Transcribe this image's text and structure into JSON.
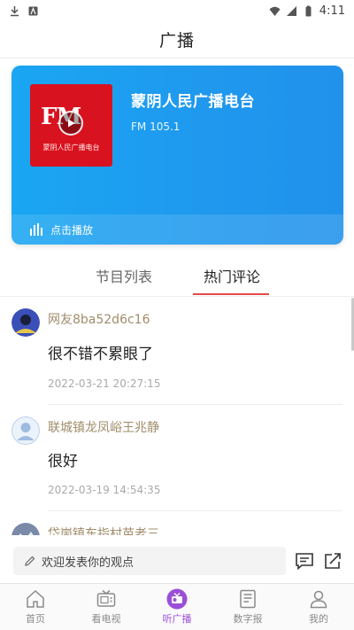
{
  "status_bar": {
    "time": "4:11"
  },
  "header": {
    "title": "广播"
  },
  "radio": {
    "cover_logo": "FM",
    "cover_caption": "蒙阴人民广播电台",
    "name": "蒙阴人民广播电台",
    "frequency": "FM 105.1",
    "play_label": "点击播放"
  },
  "tabs": [
    {
      "label": "节目列表",
      "active": false
    },
    {
      "label": "热门评论",
      "active": true
    }
  ],
  "comments": [
    {
      "username": "网友8ba52d6c16",
      "text": "很不错不累眼了",
      "time": "2022-03-21 20:27:15"
    },
    {
      "username": "联城镇龙凤峪王兆静",
      "text": "很好",
      "time": "2022-03-19 14:54:35"
    },
    {
      "username": "岱崮镇东指村苗老三",
      "text": "",
      "time": ""
    }
  ],
  "comment_input": {
    "placeholder": "欢迎发表你的观点"
  },
  "nav": [
    {
      "label": "首页",
      "icon": "home-icon"
    },
    {
      "label": "看电视",
      "icon": "tv-icon"
    },
    {
      "label": "听广播",
      "icon": "radio-icon",
      "active": true
    },
    {
      "label": "数字报",
      "icon": "newspaper-icon"
    },
    {
      "label": "我的",
      "icon": "profile-icon"
    }
  ],
  "colors": {
    "accent": "#e24a4a",
    "card": "#1aa6f2",
    "nav_active": "#9b4fd8",
    "username": "#a08c6a"
  }
}
